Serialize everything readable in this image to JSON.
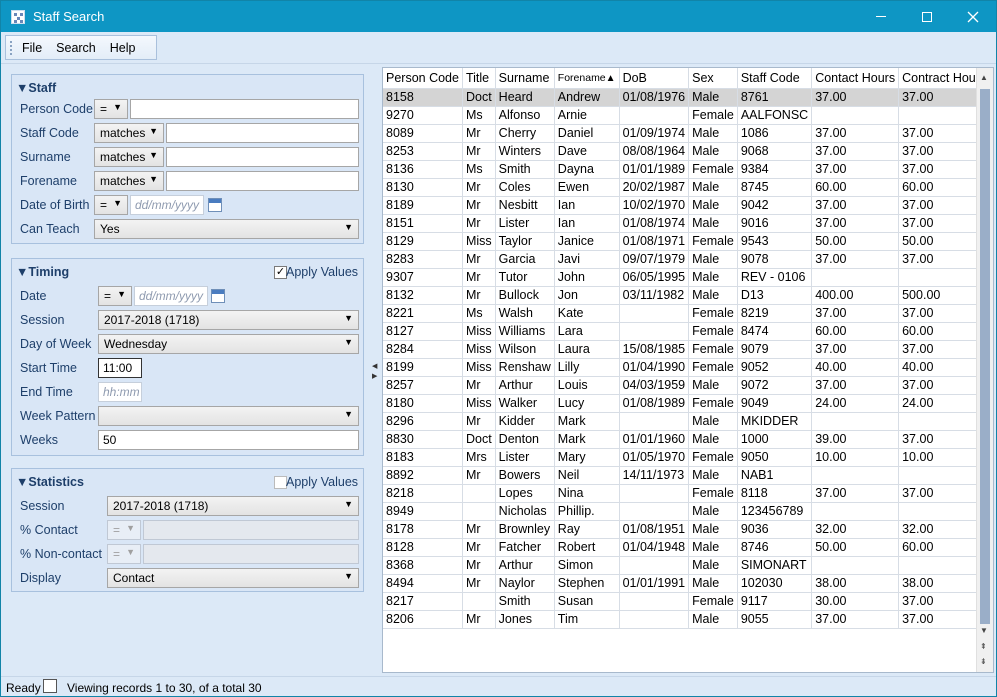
{
  "window": {
    "title": "Staff Search",
    "minimize_icon": "minimize-icon",
    "maximize_icon": "maximize-icon",
    "close_icon": "close-icon"
  },
  "menu": {
    "items": [
      "File",
      "Search",
      "Help"
    ]
  },
  "staff": {
    "title": "Staff",
    "person_code": {
      "label": "Person Code",
      "operator": "=",
      "value": ""
    },
    "staff_code": {
      "label": "Staff Code",
      "operator": "matches",
      "value": ""
    },
    "surname": {
      "label": "Surname",
      "operator": "matches",
      "value": ""
    },
    "forename": {
      "label": "Forename",
      "operator": "matches",
      "value": ""
    },
    "dob": {
      "label": "Date of Birth",
      "operator": "=",
      "placeholder": "dd/mm/yyyy"
    },
    "can_teach": {
      "label": "Can Teach",
      "value": "Yes"
    }
  },
  "timing": {
    "title": "Timing",
    "apply_values_label": "Apply Values",
    "apply_values_checked": "✓",
    "date": {
      "label": "Date",
      "operator": "=",
      "placeholder": "dd/mm/yyyy"
    },
    "session": {
      "label": "Session",
      "value": "2017-2018 (1718)"
    },
    "day_of_week": {
      "label": "Day of Week",
      "value": "Wednesday"
    },
    "start_time": {
      "label": "Start Time",
      "value": "11:00"
    },
    "end_time": {
      "label": "End Time",
      "placeholder": "hh:mm"
    },
    "week_pattern": {
      "label": "Week Pattern",
      "value": ""
    },
    "weeks": {
      "label": "Weeks",
      "value": "50"
    }
  },
  "statistics": {
    "title": "Statistics",
    "apply_values_label": "Apply Values",
    "session": {
      "label": "Session",
      "value": "2017-2018 (1718)"
    },
    "pct_contact": {
      "label": "% Contact",
      "operator": "="
    },
    "pct_noncontact": {
      "label": "% Non-contact",
      "operator": "="
    },
    "display": {
      "label": "Display",
      "value": "Contact"
    }
  },
  "grid": {
    "columns": [
      "Person Code",
      "Title",
      "Surname",
      "Forename",
      "DoB",
      "Sex",
      "Staff Code",
      "Contact Hours",
      "Contract Hours"
    ],
    "sort_indicator": "▲",
    "rows": [
      [
        "8158",
        "Doct",
        "Heard",
        "Andrew",
        "01/08/1976",
        "Male",
        "8761",
        "37.00",
        "37.00"
      ],
      [
        "9270",
        "Ms",
        "Alfonso",
        "Arnie",
        "",
        "Female",
        "AALFONSC",
        "",
        ""
      ],
      [
        "8089",
        "Mr",
        "Cherry",
        "Daniel",
        "01/09/1974",
        "Male",
        "1086",
        "37.00",
        "37.00"
      ],
      [
        "8253",
        "Mr",
        "Winters",
        "Dave",
        "08/08/1964",
        "Male",
        "9068",
        "37.00",
        "37.00"
      ],
      [
        "8136",
        "Ms",
        "Smith",
        "Dayna",
        "01/01/1989",
        "Female",
        "9384",
        "37.00",
        "37.00"
      ],
      [
        "8130",
        "Mr",
        "Coles",
        "Ewen",
        "20/02/1987",
        "Male",
        "8745",
        "60.00",
        "60.00"
      ],
      [
        "8189",
        "Mr",
        "Nesbitt",
        "Ian",
        "10/02/1970",
        "Male",
        "9042",
        "37.00",
        "37.00"
      ],
      [
        "8151",
        "Mr",
        "Lister",
        "Ian",
        "01/08/1974",
        "Male",
        "9016",
        "37.00",
        "37.00"
      ],
      [
        "8129",
        "Miss",
        "Taylor",
        "Janice",
        "01/08/1971",
        "Female",
        "9543",
        "50.00",
        "50.00"
      ],
      [
        "8283",
        "Mr",
        "Garcia",
        "Javi",
        "09/07/1979",
        "Male",
        "9078",
        "37.00",
        "37.00"
      ],
      [
        "9307",
        "Mr",
        "Tutor",
        "John",
        "06/05/1995",
        "Male",
        "REV - 0106",
        "",
        ""
      ],
      [
        "8132",
        "Mr",
        "Bullock",
        "Jon",
        "03/11/1982",
        "Male",
        "D13",
        "400.00",
        "500.00"
      ],
      [
        "8221",
        "Ms",
        "Walsh",
        "Kate",
        "",
        "Female",
        "8219",
        "37.00",
        "37.00"
      ],
      [
        "8127",
        "Miss",
        "Williams",
        "Lara",
        "",
        "Female",
        "8474",
        "60.00",
        "60.00"
      ],
      [
        "8284",
        "Miss",
        "Wilson",
        "Laura",
        "15/08/1985",
        "Female",
        "9079",
        "37.00",
        "37.00"
      ],
      [
        "8199",
        "Miss",
        "Renshaw",
        "Lilly",
        "01/04/1990",
        "Female",
        "9052",
        "40.00",
        "40.00"
      ],
      [
        "8257",
        "Mr",
        "Arthur",
        "Louis",
        "04/03/1959",
        "Male",
        "9072",
        "37.00",
        "37.00"
      ],
      [
        "8180",
        "Miss",
        "Walker",
        "Lucy",
        "01/08/1989",
        "Female",
        "9049",
        "24.00",
        "24.00"
      ],
      [
        "8296",
        "Mr",
        "Kidder",
        "Mark",
        "",
        "Male",
        "MKIDDER",
        "",
        ""
      ],
      [
        "8830",
        "Doct",
        "Denton",
        "Mark",
        "01/01/1960",
        "Male",
        "1000",
        "39.00",
        "37.00"
      ],
      [
        "8183",
        "Mrs",
        "Lister",
        "Mary",
        "01/05/1970",
        "Female",
        "9050",
        "10.00",
        "10.00"
      ],
      [
        "8892",
        "Mr",
        "Bowers",
        "Neil",
        "14/11/1973",
        "Male",
        "NAB1",
        "",
        ""
      ],
      [
        "8218",
        "",
        "Lopes",
        "Nina",
        "",
        "Female",
        "8118",
        "37.00",
        "37.00"
      ],
      [
        "8949",
        "",
        "Nicholas",
        "Phillip.",
        "",
        "Male",
        "123456789",
        "",
        ""
      ],
      [
        "8178",
        "Mr",
        "Brownley",
        "Ray",
        "01/08/1951",
        "Male",
        "9036",
        "32.00",
        "32.00"
      ],
      [
        "8128",
        "Mr",
        "Fatcher",
        "Robert",
        "01/04/1948",
        "Male",
        "8746",
        "50.00",
        "60.00"
      ],
      [
        "8368",
        "Mr",
        "Arthur",
        "Simon",
        "",
        "Male",
        "SIMONART",
        "",
        ""
      ],
      [
        "8494",
        "Mr",
        "Naylor",
        "Stephen",
        "01/01/1991",
        "Male",
        "102030",
        "38.00",
        "38.00"
      ],
      [
        "8217",
        "",
        "Smith",
        "Susan",
        "",
        "Female",
        "9117",
        "30.00",
        "37.00"
      ],
      [
        "8206",
        "Mr",
        "Jones",
        "Tim",
        "",
        "Male",
        "9055",
        "37.00",
        "37.00"
      ]
    ]
  },
  "status": {
    "ready": "Ready",
    "records": "Viewing records 1 to 30, of a total 30"
  }
}
